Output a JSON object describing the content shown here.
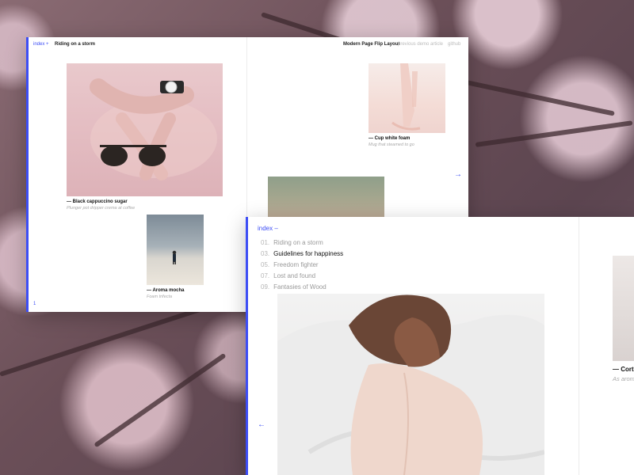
{
  "left_page": {
    "index_label": "index +",
    "page_title": "Riding on a storm",
    "nav": {
      "brand": "Modern Page Flip Layout",
      "previous_demo": "previous demo",
      "article": "article",
      "github": "github"
    },
    "items": [
      {
        "title": "Black cappuccino sugar",
        "subtitle": "Plunger pot dripper crema at coffee"
      },
      {
        "title": "Aroma mocha",
        "subtitle": "Foam trifecta"
      },
      {
        "title": "Cup white foam",
        "subtitle": "Mug that steamed to go"
      }
    ],
    "page_number": "1",
    "next_arrow": "→"
  },
  "right_page": {
    "index_label": "index –",
    "menu": [
      {
        "num": "01.",
        "label": "Riding on a storm",
        "active": false
      },
      {
        "num": "03.",
        "label": "Guidelines for happiness",
        "active": true
      },
      {
        "num": "05.",
        "label": "Freedom fighter",
        "active": false
      },
      {
        "num": "07.",
        "label": "Lost and found",
        "active": false
      },
      {
        "num": "09.",
        "label": "Fantasies of Wood",
        "active": false
      }
    ],
    "prev_arrow": "←",
    "side_item": {
      "title": "Cort",
      "subtitle": "As arom"
    }
  },
  "colors": {
    "accent": "#3d4ef5"
  }
}
